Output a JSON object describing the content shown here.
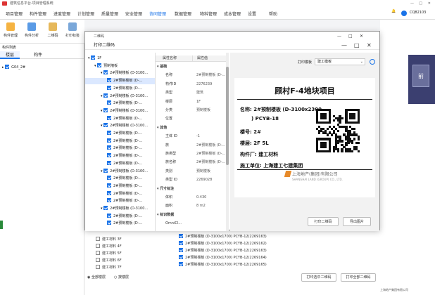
{
  "app": {
    "title": "建筑信息平台-项目管理系统",
    "menu": [
      "项目管理",
      "构件管理",
      "进度管理",
      "计划管理",
      "质量管理",
      "安全管理",
      "协同管理",
      "数据管理",
      "物料管理",
      "成本管理",
      "设置",
      "帮助"
    ],
    "active_menu_index": 6,
    "user": "CQ82103"
  },
  "toolbar": {
    "items": [
      "构件管理",
      "构件分析",
      "二维码",
      "打印标签"
    ]
  },
  "leftpanel": {
    "section": "构件列表",
    "tabs": [
      "楼层",
      "构件"
    ],
    "tree_root": "G04_2#"
  },
  "dialog": {
    "title": "二维码",
    "subtitle": "打印二维码",
    "tree": [
      {
        "label": "1F",
        "level": 0,
        "checked": true
      },
      {
        "label": "预制墙板",
        "level": 1,
        "checked": true
      },
      {
        "label": "2#预制楼板 (D-3100...",
        "level": 2,
        "checked": true
      },
      {
        "label": "2#预制楼板 (D-...",
        "level": 3,
        "checked": true,
        "selected": true
      },
      {
        "label": "2#预制楼板 (D-...",
        "level": 3,
        "checked": true
      },
      {
        "label": "2#预制楼板 (D-3100...",
        "level": 2,
        "checked": true
      },
      {
        "label": "2#预制楼板 (D-...",
        "level": 3,
        "checked": true
      },
      {
        "label": "2#预制楼板 (D-3100...",
        "level": 2,
        "checked": true
      },
      {
        "label": "2#预制楼板 (D-...",
        "level": 3,
        "checked": true
      },
      {
        "label": "2#预制楼板 (D-3100...",
        "level": 2,
        "checked": true
      },
      {
        "label": "2#预制楼板 (D-...",
        "level": 3,
        "checked": true
      },
      {
        "label": "2#预制楼板 (D-...",
        "level": 3,
        "checked": true
      },
      {
        "label": "2#预制楼板 (D-...",
        "level": 3,
        "checked": true
      },
      {
        "label": "2#预制楼板 (D-...",
        "level": 3,
        "checked": true
      },
      {
        "label": "2#预制楼板 (D-...",
        "level": 3,
        "checked": true
      },
      {
        "label": "2#预制楼板 (D-3100...",
        "level": 2,
        "checked": true
      },
      {
        "label": "2#预制楼板 (D-...",
        "level": 3,
        "checked": true
      },
      {
        "label": "2#预制楼板 (D-...",
        "level": 3,
        "checked": true
      },
      {
        "label": "2#预制楼板 (D-...",
        "level": 3,
        "checked": true
      },
      {
        "label": "2#预制楼板 (D-...",
        "level": 3,
        "checked": true
      },
      {
        "label": "2#预制楼板 (D-3100...",
        "level": 2,
        "checked": true
      },
      {
        "label": "2#预制楼板 (D-...",
        "level": 3,
        "checked": true
      },
      {
        "label": "2#预制楼板 (D-...",
        "level": 3,
        "checked": true
      }
    ],
    "props_header": [
      "属性名称",
      "属性值"
    ],
    "props": [
      {
        "k": "",
        "v": "",
        "group": "基础"
      },
      {
        "k": "名称",
        "v": "2#预制楼板 (D-..."
      },
      {
        "k": "构件ID",
        "v": "2276239"
      },
      {
        "k": "类型",
        "v": "建筑"
      },
      {
        "k": "楼层",
        "v": "1F"
      },
      {
        "k": "分类",
        "v": "预制楼板"
      },
      {
        "k": "位置",
        "v": ""
      },
      {
        "k": "",
        "v": "",
        "group": "其他"
      },
      {
        "k": "主体 ID",
        "v": "-1"
      },
      {
        "k": "族",
        "v": "2#预制楼板 (D-..."
      },
      {
        "k": "族类型",
        "v": "2#预制楼板 (D-..."
      },
      {
        "k": "族名称",
        "v": "2#预制楼板 (D-..."
      },
      {
        "k": "类别",
        "v": "预制楼板"
      },
      {
        "k": "类型 ID",
        "v": "2269028"
      },
      {
        "k": "",
        "v": "",
        "group": "尺寸标注"
      },
      {
        "k": "体积",
        "v": "0.430"
      },
      {
        "k": "面积",
        "v": "8 m2"
      },
      {
        "k": "",
        "v": "",
        "group": "标识数据"
      },
      {
        "k": "OmniCl...",
        "v": ""
      }
    ],
    "preview_label": "打印模板",
    "preview_select": "建工模板",
    "card": {
      "title": "顾村F-4地块项目",
      "name_line1": "名称: 2#预制楼板 (D-3100x2300",
      "name_line2": ") PCYB-18",
      "building": "楼号: 2#",
      "floor": "楼层: 2F 5L",
      "maker": "构件厂: 建工材料",
      "contractor": "施工单位: 上海建工七建集团",
      "logo_text": "上海地产(集团)有限公司",
      "logo_sub": "SHANGHAI LAND (GROUP) CO., LTD."
    },
    "buttons": [
      "打印二维码",
      "导出图片"
    ]
  },
  "background": {
    "left_rows": [
      "建工材料 3F",
      "建工材料 4F",
      "建工材料 5F",
      "建工材料 6F",
      "建工材料 7F"
    ],
    "right_rows": [
      "2#预制楼板 (D-3100x1700) PCYB-12(2269163)",
      "2#预制楼板 (D-3100x1700) PCYB-12(2269162)",
      "2#预制楼板 (D-3100x1700) PCYB-12(2269163)",
      "2#预制楼板 (D-3100x1700) PCYB-12(2269164)",
      "2#预制楼板 (D-3100x1700) PCYB-12(2269165)"
    ],
    "radio_all": "全部楼层",
    "radio_part": "按楼层",
    "btn_print_sel": "打印选中二维码",
    "btn_print_all": "打印全部二维码",
    "status": "上海地产集团有限公司"
  }
}
